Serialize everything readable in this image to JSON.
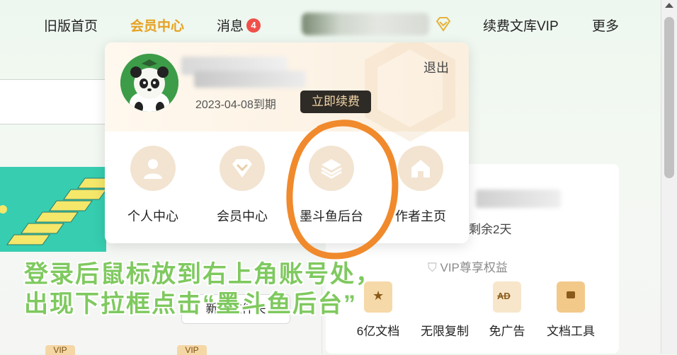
{
  "nav": {
    "old_home": "旧版首页",
    "member_center": "会员中心",
    "messages": "消息",
    "message_count": "4",
    "renew_vip": "续费文库VIP",
    "more": "更多"
  },
  "dropdown": {
    "expire_date": "2023-04-08到期",
    "renew_button": "立即续费",
    "logout": "退出",
    "items": [
      {
        "label": "个人中心",
        "icon": "person-icon"
      },
      {
        "label": "会员中心",
        "icon": "vip-diamond-icon"
      },
      {
        "label": "墨斗鱼后台",
        "icon": "layers-icon"
      },
      {
        "label": "作者主页",
        "icon": "home-icon"
      }
    ]
  },
  "background": {
    "remaining": "剩余2天",
    "vip_rights": "VIP尊享权益",
    "new_folder": "新建文件夹",
    "vip_tag": "VIP",
    "tools": [
      {
        "label": "6亿文档"
      },
      {
        "label": "无限复制"
      },
      {
        "label": "免广告"
      },
      {
        "label": "文档工具"
      }
    ]
  },
  "annotation": {
    "line1": "登录后鼠标放到右上角账号处，",
    "line2": "出现下拉框点击“墨斗鱼后台”"
  },
  "colors": {
    "accent": "#e6a122",
    "badge": "#f0504a",
    "annotation_text": "#7fc95f",
    "highlight_ring": "#f08a2c",
    "icon_circle": "#f2e4d1"
  }
}
